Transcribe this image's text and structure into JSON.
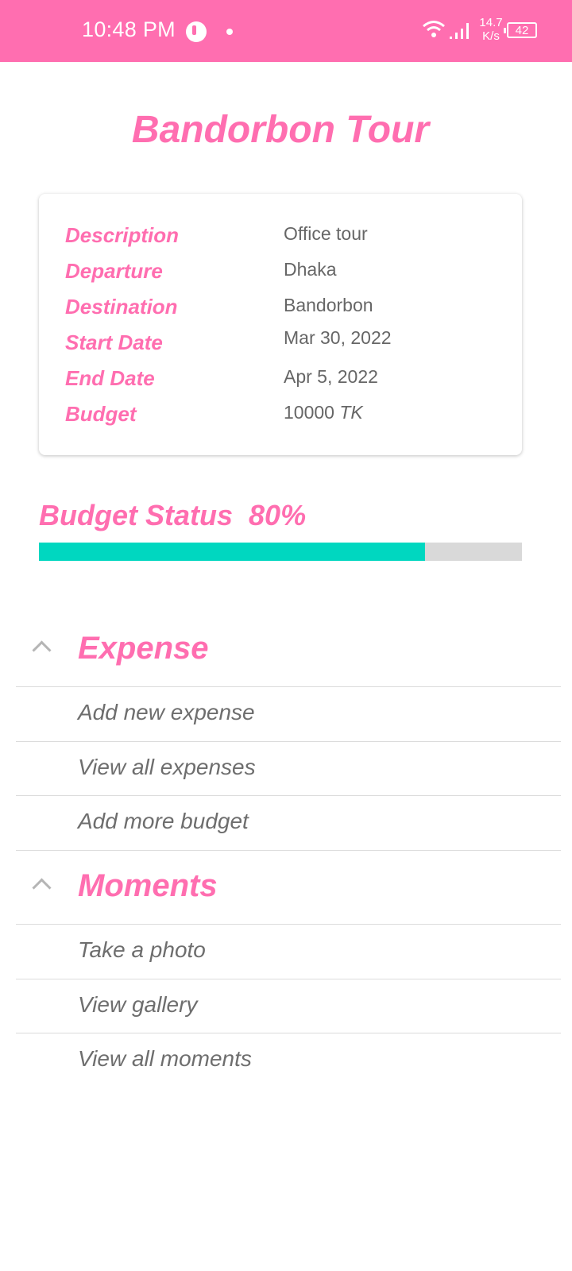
{
  "status_bar": {
    "time": "10:48 PM",
    "speed_value": "14.7",
    "speed_unit": "K/s",
    "battery": "42"
  },
  "tour": {
    "title": "Bandorbon Tour",
    "details": [
      {
        "label": "Description",
        "value": "Office tour"
      },
      {
        "label": "Departure",
        "value": "Dhaka"
      },
      {
        "label": "Destination",
        "value": "Bandorbon"
      },
      {
        "label": "Start Date",
        "value": "Mar 30, 2022"
      },
      {
        "label": "End Date",
        "value": "Apr 5, 2022"
      },
      {
        "label": "Budget",
        "value": "10000",
        "unit": "TK"
      }
    ]
  },
  "budget_status": {
    "label": "Budget Status",
    "percent_text": "80%",
    "percent": 80
  },
  "sections": {
    "expense": {
      "title": "Expense",
      "items": [
        "Add new expense",
        "View all expenses",
        "Add more budget"
      ]
    },
    "moments": {
      "title": "Moments",
      "items": [
        "Take a photo",
        "View gallery",
        "View all moments"
      ]
    }
  },
  "colors": {
    "accent": "#ff6eb0",
    "progress_fill": "#00d7c0",
    "progress_track": "#d9d9d9",
    "value_text": "#666666"
  }
}
